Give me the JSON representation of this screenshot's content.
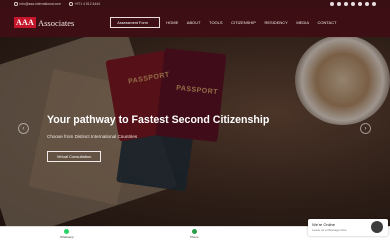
{
  "topbar": {
    "email": "info@aaa-international.com",
    "phone": "+971 4 512 4444",
    "social_icons": [
      "twitter-icon",
      "facebook-icon",
      "pinterest-icon",
      "instagram-icon",
      "linkedin-icon",
      "youtube-icon",
      "whatsapp-icon"
    ]
  },
  "header": {
    "logo_mark": "AAA",
    "logo_text": "Associates",
    "assessment_label": "Assessment Form",
    "nav": [
      "HOME",
      "ABOUT",
      "TOOLS",
      "CITIZENSHIP",
      "RESIDENCY",
      "MEDIA",
      "CONTACT"
    ]
  },
  "hero": {
    "passport_label_1": "PASSPORT",
    "passport_label_2": "PASSPORT",
    "title": "Your pathway to Fastest Second Citizenship",
    "subtitle": "Choose from Distinct International Countries",
    "cta_label": "Virtual Consultation",
    "prev_arrow": "‹",
    "next_arrow": "›"
  },
  "bottom_bar": {
    "whatsapp_label": "Whatsapp",
    "phone_label": "Phone"
  },
  "chat": {
    "title": "We're Online",
    "subtitle": "Leave us a Message Now"
  },
  "colors": {
    "header_bg": "#3d0e14",
    "logo_red": "#c6162b",
    "whatsapp_green": "#25d366"
  }
}
